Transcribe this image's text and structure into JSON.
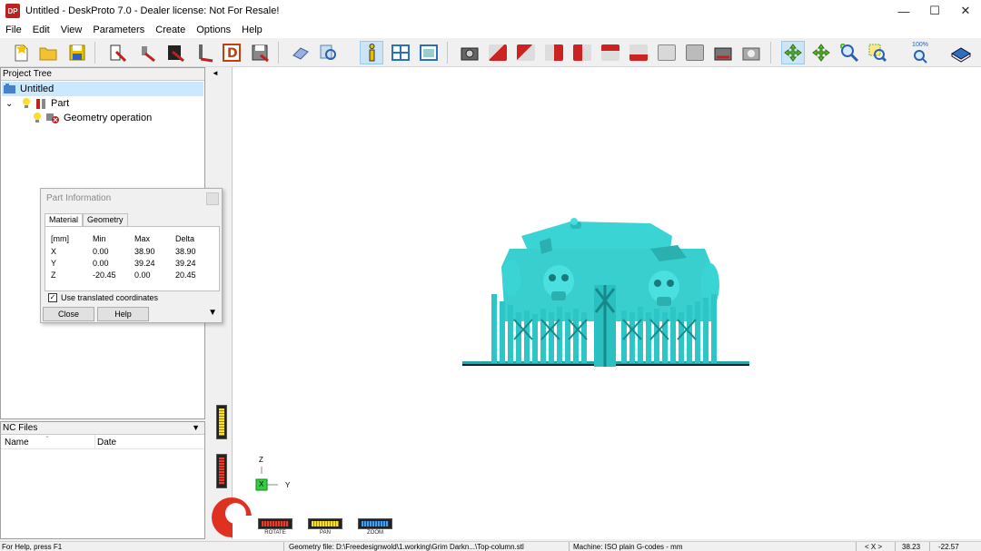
{
  "window": {
    "title": "Untitled - DeskProto 7.0 - Dealer license: Not For Resale!",
    "app_icon_text": "DP",
    "minimize_glyph": "—",
    "maximize_glyph": "☐",
    "close_glyph": "✕"
  },
  "menu": [
    "File",
    "Edit",
    "View",
    "Parameters",
    "Create",
    "Options",
    "Help"
  ],
  "toolbar": {
    "zoom_label": "100%",
    "buttons": [
      "new-file-icon",
      "open-folder-icon",
      "save-icon",
      "wizard-icon",
      "wizard-2-icon",
      "wizard-3-icon",
      "wizard-4-icon",
      "wizard-d-icon",
      "export-icon",
      "eraser-icon",
      "inspect-icon",
      "info-icon",
      "layout-icon",
      "window-icon",
      "camera-icon",
      "view-cube-icons",
      "pan-icon",
      "move-icon",
      "zoom-in-icon",
      "zoom-fit-icon",
      "zoom-100-icon",
      "help-book-icon"
    ]
  },
  "project_tree": {
    "header": "Project Tree",
    "items": [
      {
        "label": "Untitled"
      },
      {
        "label": "Part"
      },
      {
        "label": "Geometry operation"
      }
    ]
  },
  "nc_files": {
    "header": "NC Files",
    "columns": [
      "Name",
      "Date"
    ]
  },
  "part_info": {
    "title": "Part Information",
    "tabs": [
      "Material",
      "Geometry"
    ],
    "headers": [
      "[mm]",
      "Min",
      "Max",
      "Delta"
    ],
    "rows": [
      {
        "axis": "X",
        "min": "0.00",
        "max": "38.90",
        "delta": "38.90"
      },
      {
        "axis": "Y",
        "min": "0.00",
        "max": "39.24",
        "delta": "39.24"
      },
      {
        "axis": "Z",
        "min": "-20.45",
        "max": "0.00",
        "delta": "20.45"
      }
    ],
    "checkbox_label": "Use translated coordinates",
    "checkbox_checked": true,
    "close_label": "Close",
    "help_label": "Help"
  },
  "viewport": {
    "axis_z": "Z",
    "axis_y": "Y",
    "axis_x": "X",
    "rotate_label": "ROTATE",
    "pan_label": "PAN",
    "zoom_label": "ZOOM",
    "model_color": "#3ad4d4"
  },
  "status": {
    "help": "For Help, press F1",
    "geometry": "Geometry file: D:\\Freedesignwold\\1.working\\Grim Darkn...\\Top-column.stl",
    "machine": "Machine: ISO plain G-codes - mm",
    "coord_label": "< X >",
    "x_value": "38.23",
    "y_value": "-22.57"
  }
}
